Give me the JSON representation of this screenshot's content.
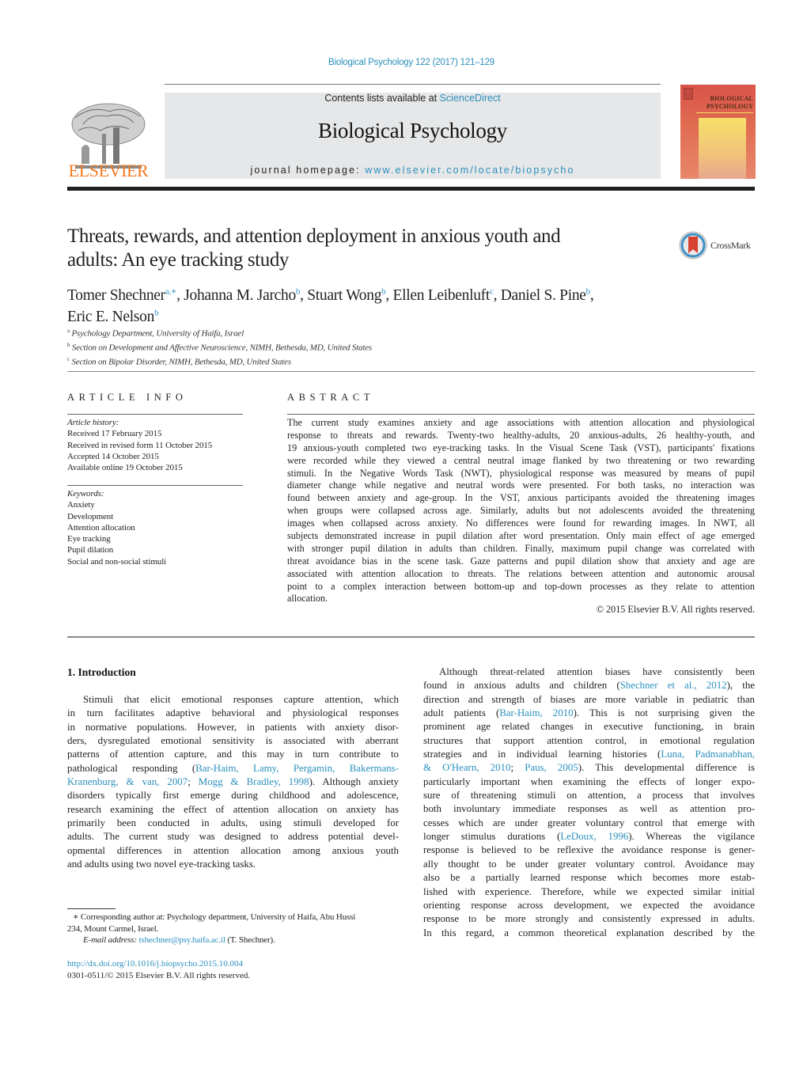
{
  "header": {
    "citation": "Biological Psychology 122 (2017) 121–129",
    "contents_prefix": "Contents lists available at ",
    "contents_link": "ScienceDirect",
    "journal_name": "Biological Psychology",
    "homepage_prefix": "journal homepage: ",
    "homepage_link": "www.elsevier.com/locate/biopsycho",
    "publisher_logo": "ELSEVIER",
    "cover_title_line1": "BIOLOGICAL",
    "cover_title_line2": "PSYCHOLOGY",
    "crossmark_label": "CrossMark"
  },
  "colors": {
    "link": "#2a8fbd",
    "elsevier_orange": "#f47a20",
    "masthead_gray": "#e6e7e8",
    "heavy_rule": "#231f20"
  },
  "article": {
    "title_line1": "Threats, rewards, and attention deployment in anxious youth and",
    "title_line2": "adults: An eye tracking study",
    "authors": [
      {
        "name": "Tomer Shechner",
        "sup": "a,∗",
        "sep": ", "
      },
      {
        "name": "Johanna M. Jarcho",
        "sup": "b",
        "sep": ", "
      },
      {
        "name": "Stuart Wong",
        "sup": "b",
        "sep": ", "
      },
      {
        "name": "Ellen Leibenluft",
        "sup": "c",
        "sep": ", "
      },
      {
        "name": "Daniel S. Pine",
        "sup": "b",
        "sep": ","
      },
      {
        "name": "Eric E. Nelson",
        "sup": "b",
        "sep": ""
      }
    ],
    "affiliations": [
      {
        "mark": "a",
        "text": "Psychology Department, University of Haifa, Israel"
      },
      {
        "mark": "b",
        "text": "Section on Development and Affective Neuroscience, NIMH, Bethesda, MD, United States"
      },
      {
        "mark": "c",
        "text": "Section on Bipolar Disorder, NIMH, Bethesda, MD, United States"
      }
    ]
  },
  "article_info": {
    "heading": "ARTICLE INFO",
    "history_label": "Article history:",
    "history": [
      "Received 17 February 2015",
      "Received in revised form 11 October 2015",
      "Accepted 14 October 2015",
      "Available online 19 October 2015"
    ],
    "keywords_label": "Keywords:",
    "keywords": [
      "Anxiety",
      "Development",
      "Attention allocation",
      "Eye tracking",
      "Pupil dilation",
      "Social and non-social stimuli"
    ]
  },
  "abstract": {
    "heading": "ABSTRACT",
    "lines": [
      "The current study examines anxiety and age associations with attention allocation and physiological",
      "response to threats and rewards. Twenty-two healthy-adults, 20 anxious-adults, 26 healthy-youth, and",
      "19 anxious-youth completed two eye-tracking tasks. In the Visual Scene Task (VST), participants' fixations",
      "were recorded while they viewed a central neutral image flanked by two threatening or two rewarding",
      "stimuli. In the Negative Words Task (NWT), physiological response was measured by means of pupil",
      "diameter change while negative and neutral words were presented. For both tasks, no interaction was",
      "found between anxiety and age-group. In the VST, anxious participants avoided the threatening images",
      "when groups were collapsed across age. Similarly, adults but not adolescents avoided the threatening",
      "images when collapsed across anxiety. No differences were found for rewarding images. In NWT, all",
      "subjects demonstrated increase in pupil dilation after word presentation. Only main effect of age emerged",
      "with stronger pupil dilation in adults than children. Finally, maximum pupil change was correlated with",
      "threat avoidance bias in the scene task. Gaze patterns and pupil dilation show that anxiety and age are",
      "associated with attention allocation to threats. The relations between attention and autonomic arousal",
      "point to a complex interaction between bottom-up and top-down processes as they relate to attention",
      "allocation."
    ],
    "copyright": "© 2015 Elsevier B.V. All rights reserved."
  },
  "body": {
    "section_heading": "1.  Introduction",
    "left_column": [
      {
        "text": "Stimuli that elicit emotional responses capture attention, which",
        "indent": true
      },
      {
        "text": "in turn facilitates adaptive behavioral and physiological responses"
      },
      {
        "text": "in normative populations. However, in patients with anxiety disor-"
      },
      {
        "text": "ders, dysregulated emotional sensitivity is associated with aberrant"
      },
      {
        "text": "patterns of attention capture, and this may in turn contribute to"
      },
      {
        "pre": "pathological responding (",
        "link": "Bar-Haim, Lamy, Pergamin, Bakermans-",
        "post": ""
      },
      {
        "pre": "",
        "link": "Kranenburg, & van, 2007",
        "post": "; ",
        "link2": "Mogg & Bradley, 1998",
        "post2": "). Although anxiety"
      },
      {
        "text": "disorders typically first emerge during childhood and adolescence,"
      },
      {
        "text": "research examining the effect of attention allocation on anxiety has"
      },
      {
        "text": "primarily been conducted in adults, using stimuli developed for"
      },
      {
        "text": "adults. The current study was designed to address potential devel-"
      },
      {
        "text": "opmental differences in attention allocation among anxious youth"
      },
      {
        "text": "and adults using two novel eye-tracking tasks.",
        "last": true
      }
    ],
    "right_column": [
      {
        "text": "Although threat-related attention biases have consistently been",
        "indent": true
      },
      {
        "pre": "found in anxious adults and children (",
        "link": "Shechner et al., 2012",
        "post": "), the"
      },
      {
        "text": "direction and strength of biases are more variable in pediatric than"
      },
      {
        "pre": "adult patients (",
        "link": "Bar-Haim, 2010",
        "post": "). This is not surprising given the"
      },
      {
        "text": "prominent age related changes in executive functioning, in brain"
      },
      {
        "text": "structures that support attention control, in emotional regulation"
      },
      {
        "pre": "strategies and in individual learning histories (",
        "link": "Luna, Padmanabhan,",
        "post": ""
      },
      {
        "pre": "",
        "link": "& O'Hearn, 2010",
        "post": "; ",
        "link2": "Paus, 2005",
        "post2": "). This developmental difference is"
      },
      {
        "text": "particularly important when examining the effects of longer expo-"
      },
      {
        "text": "sure of threatening stimuli on attention, a process that involves"
      },
      {
        "text": "both involuntary immediate responses as well as attention pro-"
      },
      {
        "text": "cesses which are under greater voluntary control that emerge with"
      },
      {
        "pre": "longer stimulus durations (",
        "link": "LeDoux, 1996",
        "post": "). Whereas the vigilance"
      },
      {
        "text": "response is believed to be reflexive the avoidance response is gener-"
      },
      {
        "text": "ally thought to be under greater voluntary control. Avoidance may"
      },
      {
        "text": "also be a partially learned response which becomes more estab-"
      },
      {
        "text": "lished with experience. Therefore, while we expected similar initial"
      },
      {
        "text": "orienting response across development, we expected the avoidance"
      },
      {
        "text": "response to be more strongly and consistently expressed in adults."
      },
      {
        "text": "In this regard, a common theoretical explanation described by the"
      }
    ]
  },
  "footnotes": {
    "corresponding_line1": "∗  Corresponding author at: Psychology department, University of Haifa, Abu Hussi",
    "corresponding_line2": "234, Mount Carmel, Israel.",
    "email_label": "E-mail address: ",
    "email": "tshechner@psy.haifa.ac.il",
    "email_suffix": " (T. Shechner).",
    "doi": "http://dx.doi.org/10.1016/j.biopsycho.2015.10.004",
    "issn_copyright": "0301-0511/© 2015 Elsevier B.V. All rights reserved."
  }
}
